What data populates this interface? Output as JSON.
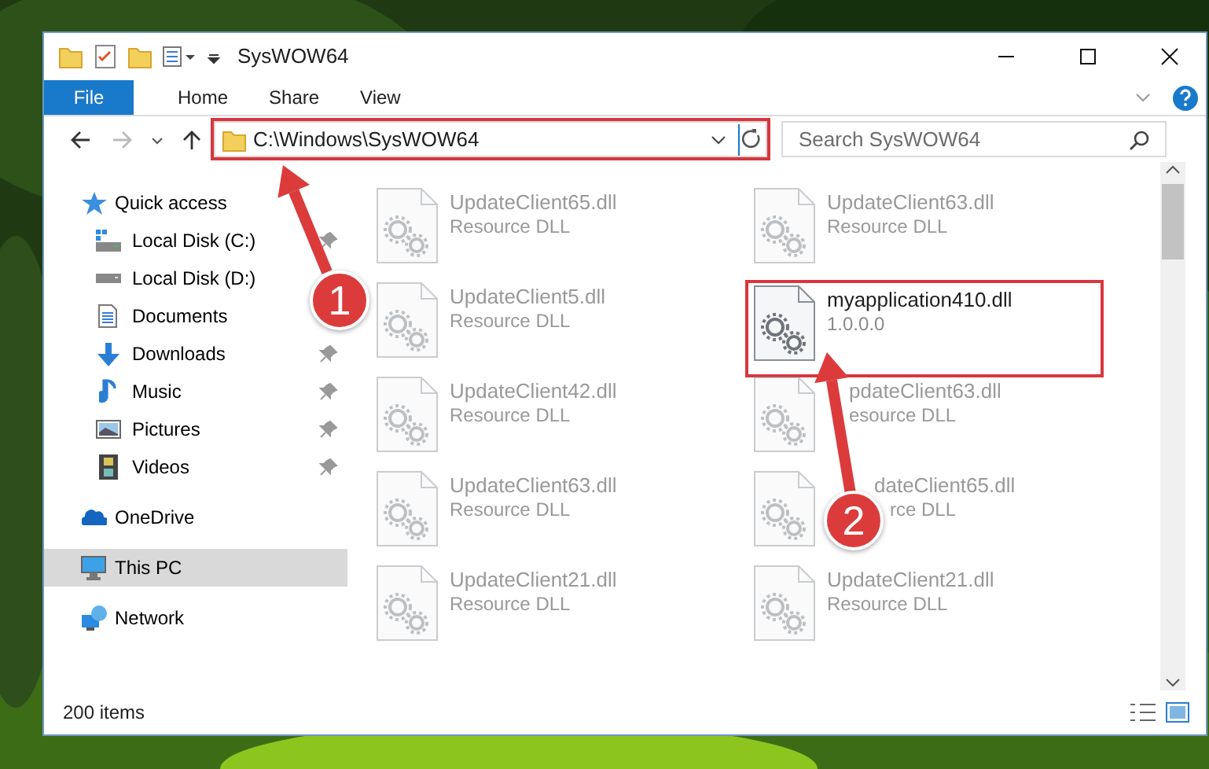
{
  "window": {
    "title": "SysWOW64"
  },
  "ribbon_tabs": [
    {
      "label": "File",
      "kind": "file"
    },
    {
      "label": "Home",
      "kind": "tab"
    },
    {
      "label": "Share",
      "kind": "tab"
    },
    {
      "label": "View",
      "kind": "tab"
    }
  ],
  "address_bar": {
    "path": "C:\\Windows\\SysWOW64",
    "outlined": true
  },
  "search": {
    "placeholder": "Search SysWOW64"
  },
  "sidebar": {
    "items": [
      {
        "label": "Quick access",
        "selected": false,
        "children": [
          {
            "label": "Local Disk (C:)",
            "pinned": true,
            "selected": false
          },
          {
            "label": "Local Disk (D:)",
            "selected": false
          },
          {
            "label": "Documents",
            "selected": false
          },
          {
            "label": "Downloads",
            "pinned": true,
            "selected": false
          },
          {
            "label": "Music",
            "pinned": true,
            "selected": false
          },
          {
            "label": "Pictures",
            "pinned": true,
            "selected": false
          },
          {
            "label": "Videos",
            "pinned": true,
            "selected": false
          }
        ]
      },
      {
        "label": "OneDrive",
        "selected": false
      },
      {
        "label": "This PC",
        "selected": true
      },
      {
        "label": "Network",
        "selected": false
      }
    ]
  },
  "files": [
    {
      "name": "UpdateClient65.dll",
      "detail": "Resource DLL",
      "dimmed": true,
      "outlined": false
    },
    {
      "name": "UpdateClient63.dll",
      "detail": "Resource DLL",
      "dimmed": true,
      "outlined": false
    },
    {
      "name": "UpdateClient5.dll",
      "detail": "Resource DLL",
      "dimmed": true,
      "outlined": false
    },
    {
      "name": "myapplication410.dll",
      "detail": "1.0.0.0",
      "dimmed": false,
      "outlined": true
    },
    {
      "name": "UpdateClient42.dll",
      "detail": "Resource DLL",
      "dimmed": true,
      "outlined": false
    },
    {
      "name": "pdateClient63.dll",
      "detail": "esource DLL",
      "dimmed": true,
      "outlined": false
    },
    {
      "name": "UpdateClient63.dll",
      "detail": "Resource DLL",
      "dimmed": true,
      "outlined": false
    },
    {
      "name": "dateClient65.dll",
      "detail": "rce DLL",
      "dimmed": true,
      "outlined": false
    },
    {
      "name": "UpdateClient21.dll",
      "detail": "Resource DLL",
      "dimmed": true,
      "outlined": false
    },
    {
      "name": "UpdateClient21.dll",
      "detail": "Resource DLL",
      "dimmed": true,
      "outlined": false
    }
  ],
  "status_bar": {
    "text": "200 items"
  },
  "annotations": [
    {
      "number": "1"
    },
    {
      "number": "2"
    }
  ]
}
